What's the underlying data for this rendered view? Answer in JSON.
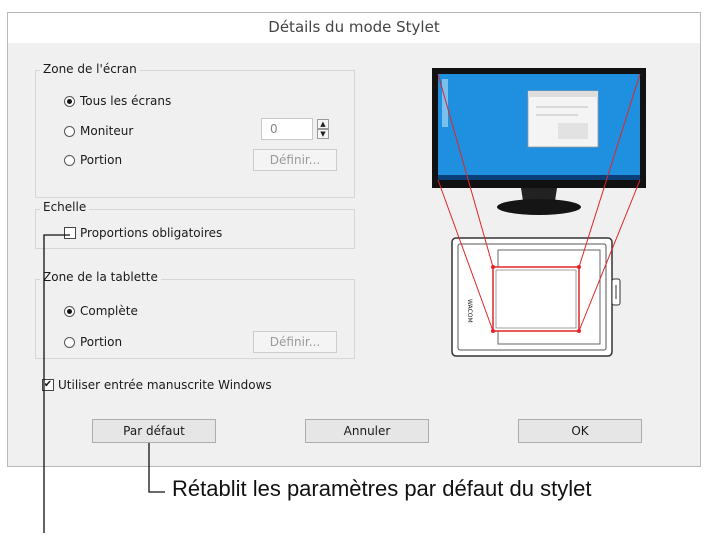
{
  "dialog": {
    "title": "Détails du mode Stylet",
    "screen_area": {
      "label": "Zone de l'écran",
      "options": [
        "Tous les écrans",
        "Moniteur",
        "Portion"
      ],
      "selected": "Tous les écrans",
      "monitor_value": "0",
      "define_label": "Définir..."
    },
    "scale": {
      "label": "Echelle",
      "checkbox_label": "Proportions obligatoires",
      "checked": false
    },
    "tablet_area": {
      "label": "Zone de la tablette",
      "options": [
        "Complète",
        "Portion"
      ],
      "selected": "Complète",
      "define_label": "Définir..."
    },
    "windows_ink": {
      "label": "Utiliser entrée manuscrite Windows",
      "checked": true
    },
    "buttons": {
      "default": "Par défaut",
      "cancel": "Annuler",
      "ok": "OK"
    }
  },
  "annotation": {
    "text": "Rétablit les paramètres par défaut du stylet"
  },
  "colors": {
    "dialog_bg": "#f0f0f0",
    "screen_blue": "#1f8fe0",
    "mapping_lines": "#e32626"
  },
  "illustration": {
    "tablet_brand": "WACOM"
  }
}
